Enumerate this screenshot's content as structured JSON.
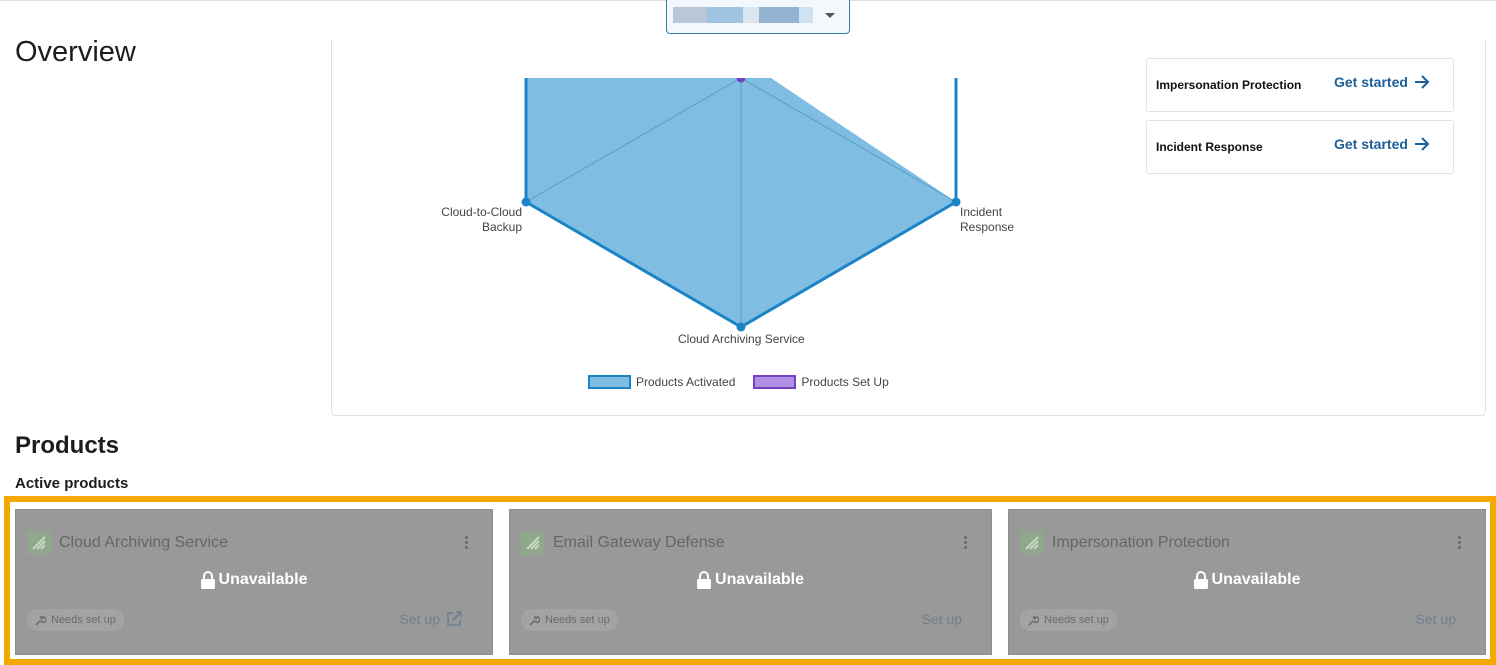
{
  "page": {
    "title": "Overview"
  },
  "account_selector": {
    "value": ""
  },
  "radar_chart": {
    "axes": [
      "Cloud-to-Cloud Backup",
      "Cloud Archiving Service",
      "Incident Response"
    ],
    "axis_labels": {
      "backup_line1": "Cloud-to-Cloud",
      "backup_line2": "Backup",
      "archiving": "Cloud Archiving Service",
      "incident_line1": "Incident",
      "incident_line2": "Response"
    },
    "legend": [
      {
        "label": "Products Activated",
        "color": "#1a84c7"
      },
      {
        "label": "Products Set Up",
        "color": "#7541c4"
      }
    ]
  },
  "setup_list": [
    {
      "name": "Impersonation Protection",
      "action": "Get started"
    },
    {
      "name": "Incident Response",
      "action": "Get started"
    }
  ],
  "products": {
    "title": "Products",
    "subtitle": "Active products",
    "cards": [
      {
        "name": "Cloud Archiving Service",
        "status": "Unavailable",
        "badge": "Needs set up",
        "action": "Set up",
        "external": true
      },
      {
        "name": "Email Gateway Defense",
        "status": "Unavailable",
        "badge": "Needs set up",
        "action": "Set up",
        "external": false
      },
      {
        "name": "Impersonation Protection",
        "status": "Unavailable",
        "badge": "Needs set up",
        "action": "Set up",
        "external": false
      }
    ]
  },
  "colors": {
    "highlight": "#f5a800",
    "link": "#1e5f9a",
    "activated_fill": "#7fbde2",
    "activated_stroke": "#1a84c7",
    "setup_point": "#7541c4"
  }
}
